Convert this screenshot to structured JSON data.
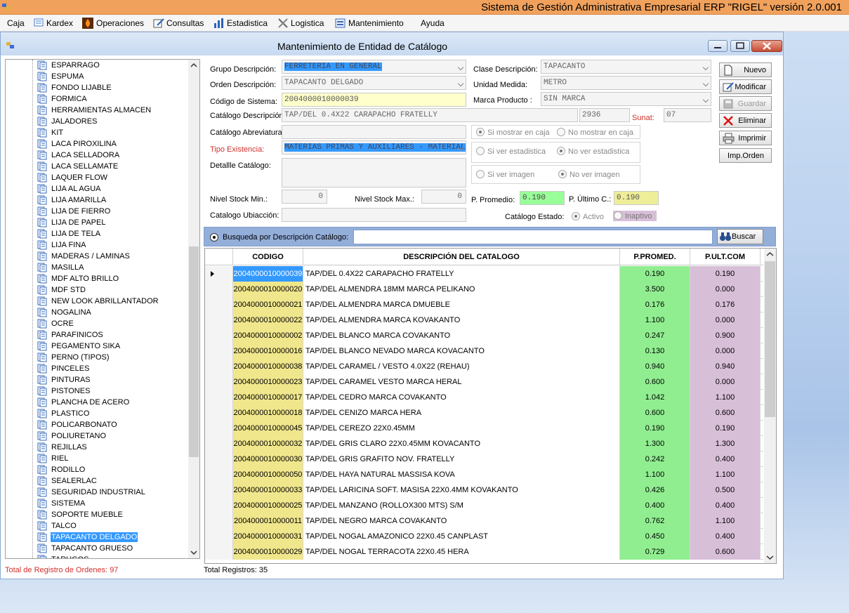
{
  "app_title": "Sistema de Gestión Administrativa Empresarial ERP  \"RIGEL\" versión 2.0.001",
  "menu": [
    "Caja",
    "Kardex",
    "Operaciones",
    "Consultas",
    "Estadistica",
    "Logistica",
    "Mantenimiento",
    "Ayuda"
  ],
  "window_title": "Mantenimiento de Entidad de Catálogo",
  "tree_items": [
    "ESPARRAGO",
    "ESPUMA",
    "FONDO LIJABLE",
    "FORMICA",
    "HERRAMIENTAS ALMACEN",
    "JALADORES",
    "KIT",
    "LACA PIROXILINA",
    "LACA SELLADORA",
    "LACA SELLAMATE",
    "LAQUER FLOW",
    "LIJA AL AGUA",
    "LIJA AMARILLA",
    "LIJA DE FIERRO",
    "LIJA DE PAPEL",
    "LIJA DE TELA",
    "LIJA FINA",
    "MADERAS / LAMINAS",
    "MASILLA",
    "MDF ALTO BRILLO",
    "MDF STD",
    "NEW LOOK ABRILLANTADOR",
    "NOGALINA",
    "OCRE",
    "PARAFINICOS",
    "PEGAMENTO SIKA",
    "PERNO (TIPOS)",
    "PINCELES",
    "PINTURAS",
    "PISTONES",
    "PLANCHA DE ACERO",
    "PLASTICO",
    "POLICARBONATO",
    "POLIURETANO",
    "REJILLAS",
    "RIEL",
    "RODILLO",
    "SEALERLAC",
    "SEGURIDAD INDUSTRIAL",
    "SISTEMA",
    "SOPORTE MUEBLE",
    "TALCO",
    "TAPACANTO DELGADO",
    "TAPACANTO GRUESO",
    "TARUGOS"
  ],
  "tree_selected": "TAPACANTO DELGADO",
  "form": {
    "grupo_label": "Grupo Descripción:",
    "grupo_value": "FERRETERIA EN GENERAL",
    "clase_label": "Clase Descripción:",
    "clase_value": "TAPACANTO",
    "orden_label": "Orden Descripción:",
    "orden_value": "TAPACANTO DELGADO",
    "unidad_label": "Unidad Medida:",
    "unidad_value": "METRO",
    "codigo_label": "Código de Sistema:",
    "codigo_value": "2004000010000039",
    "marca_label": "Marca Producto :",
    "marca_value": "SIN MARCA",
    "catdesc_label": "Catálogo Descripción:",
    "catdesc_value": "TAP/DEL 0.4X22 CARAPACHO FRATELLY",
    "catdesc_num": "2936",
    "sunat_label": "Sunat:",
    "sunat_value": "07",
    "abrev_label": "Catálogo Abreviatura",
    "tipo_label": "Tipo Existencia:",
    "tipo_value": "MATERIAS PRIMAS Y AUXILIARES - MATERIALES",
    "detalle_label": "Detallle Catálogo:",
    "stockmin_label": "Nivel Stock Min.:",
    "stockmin_value": "0",
    "stockmax_label": "Nivel Stock Max.:",
    "stockmax_value": "0",
    "ppromedio_label": "P. Promedio:",
    "ppromedio_value": "0.190",
    "pultimo_label": "P. Último C.:",
    "pultimo_value": "0.190",
    "ubicacion_label": "Catalogo Ubiacción:",
    "estado_label": "Catálogo Estado:",
    "estado_activo": "Activo",
    "estado_inactivo": "Inaptivo",
    "r_caja_si": "Si mostrar en caja",
    "r_caja_no": "No mostrar en caja",
    "r_est_si": "Si ver estadistica",
    "r_est_no": "No ver estadistica",
    "r_img_si": "Si ver imagen",
    "r_img_no": "No ver imagen"
  },
  "buttons": {
    "nuevo": "Nuevo",
    "modificar": "Modificar",
    "guardar": "Guardar",
    "eliminar": "Eliminar",
    "imprimir": "Imprimir",
    "imporden": "Imp.Orden"
  },
  "search": {
    "label": "Busqueda por Descripción Catálogo:",
    "button": "Buscar"
  },
  "grid": {
    "headers": [
      "CODIGO",
      "DESCRIPCIÓN DEL CATALOGO",
      "P.PROMED.",
      "P.ULT.COM"
    ],
    "rows": [
      [
        "2004000010000039",
        "TAP/DEL 0.4X22 CARAPACHO FRATELLY",
        "0.190",
        "0.190"
      ],
      [
        "2004000010000020",
        "TAP/DEL ALMENDRA 18MM MARCA PELIKANO",
        "3.500",
        "0.000"
      ],
      [
        "2004000010000021",
        "TAP/DEL ALMENDRA MARCA DMUEBLE",
        "0.176",
        "0.176"
      ],
      [
        "2004000010000022",
        "TAP/DEL ALMENDRA MARCA KOVAKANTO",
        "1.100",
        "0.000"
      ],
      [
        "2004000010000002",
        "TAP/DEL BLANCO MARCA COVAKANTO",
        "0.247",
        "0.900"
      ],
      [
        "2004000010000016",
        "TAP/DEL BLANCO NEVADO MARCA KOVACANTO",
        "0.130",
        "0.000"
      ],
      [
        "2004000010000038",
        "TAP/DEL CARAMEL / VESTO 4.0X22 (REHAU)",
        "0.940",
        "0.940"
      ],
      [
        "2004000010000023",
        "TAP/DEL CARAMEL VESTO MARCA HERAL",
        "0.600",
        "0.000"
      ],
      [
        "2004000010000017",
        "TAP/DEL CEDRO MARCA COVAKANTO",
        "1.042",
        "1.100"
      ],
      [
        "2004000010000018",
        "TAP/DEL CENIZO MARCA HERA",
        "0.600",
        "0.600"
      ],
      [
        "2004000010000045",
        "TAP/DEL CEREZO 22X0.45MM",
        "0.190",
        "0.190"
      ],
      [
        "2004000010000032",
        "TAP/DEL GRIS CLARO 22X0.45MM KOVACANTO",
        "1.300",
        "1.300"
      ],
      [
        "2004000010000030",
        "TAP/DEL GRIS GRAFITO NOV. FRATELLY",
        "0.242",
        "0.400"
      ],
      [
        "2004000010000050",
        "TAP/DEL HAYA NATURAL MASSISA KOVA",
        "1.100",
        "1.100"
      ],
      [
        "2004000010000033",
        "TAP/DEL LARICINA SOFT. MASISA 22X0.4MM KOVAKANTO",
        "0.426",
        "0.500"
      ],
      [
        "2004000010000025",
        "TAP/DEL MANZANO (ROLLOX300 MTS) S/M",
        "0.400",
        "0.400"
      ],
      [
        "2004000010000011",
        "TAP/DEL NEGRO MARCA COVAKANTO",
        "0.762",
        "1.100"
      ],
      [
        "2004000010000031",
        "TAP/DEL NOGAL AMAZONICO 22X0.45 CANPLAST",
        "0.450",
        "0.400"
      ],
      [
        "2004000010000029",
        "TAP/DEL NOGAL TERRACOTA 22X0.45 HERA",
        "0.729",
        "0.600"
      ]
    ]
  },
  "status": {
    "ordenes": "Total de Registro de Ordenes:  97",
    "registros": "Total Registros:  35"
  }
}
